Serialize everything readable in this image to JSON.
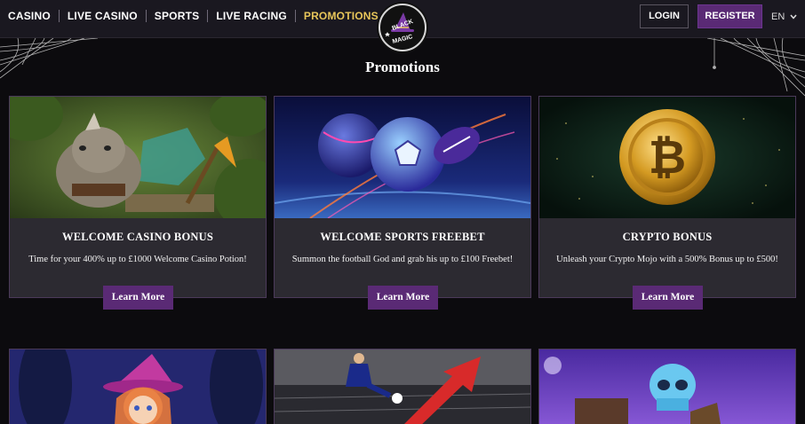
{
  "header": {
    "nav": [
      {
        "label": "CASINO",
        "active": false
      },
      {
        "label": "LIVE CASINO",
        "active": false
      },
      {
        "label": "SPORTS",
        "active": false
      },
      {
        "label": "LIVE RACING",
        "active": false
      },
      {
        "label": "PROMOTIONS",
        "active": true
      }
    ],
    "logo_text": [
      "BLACK",
      "MAGIC"
    ],
    "login_label": "LOGIN",
    "register_label": "REGISTER",
    "language": "EN",
    "language_icon": "chevron-down-icon"
  },
  "page": {
    "title": "Promotions"
  },
  "promotions": [
    {
      "title": "WELCOME CASINO BONUS",
      "description": "Time for your 400% up to £1000 Welcome Casino Potion!",
      "button": "Learn More",
      "image": "rhino-warrior-jungle"
    },
    {
      "title": "WELCOME SPORTS FREEBET",
      "description": "Summon the football God and grab his up to £100 Freebet!",
      "button": "Learn More",
      "image": "neon-sports-balls"
    },
    {
      "title": "CRYPTO BONUS",
      "description": "Unleash your Crypto Mojo with a 500% Bonus up to £500!",
      "button": "Learn More",
      "image": "gold-bitcoin-coin"
    }
  ],
  "more_promotions": [
    {
      "image": "witch-girl-haunted-forest"
    },
    {
      "image": "football-player-red-arrow"
    },
    {
      "image": "skull-character-purple-sky"
    }
  ],
  "colors": {
    "background": "#0c0b0e",
    "header": "#1a1820",
    "accent_purple": "#5a2a75",
    "active_nav": "#e8c65a",
    "card": "#2c2a31"
  }
}
